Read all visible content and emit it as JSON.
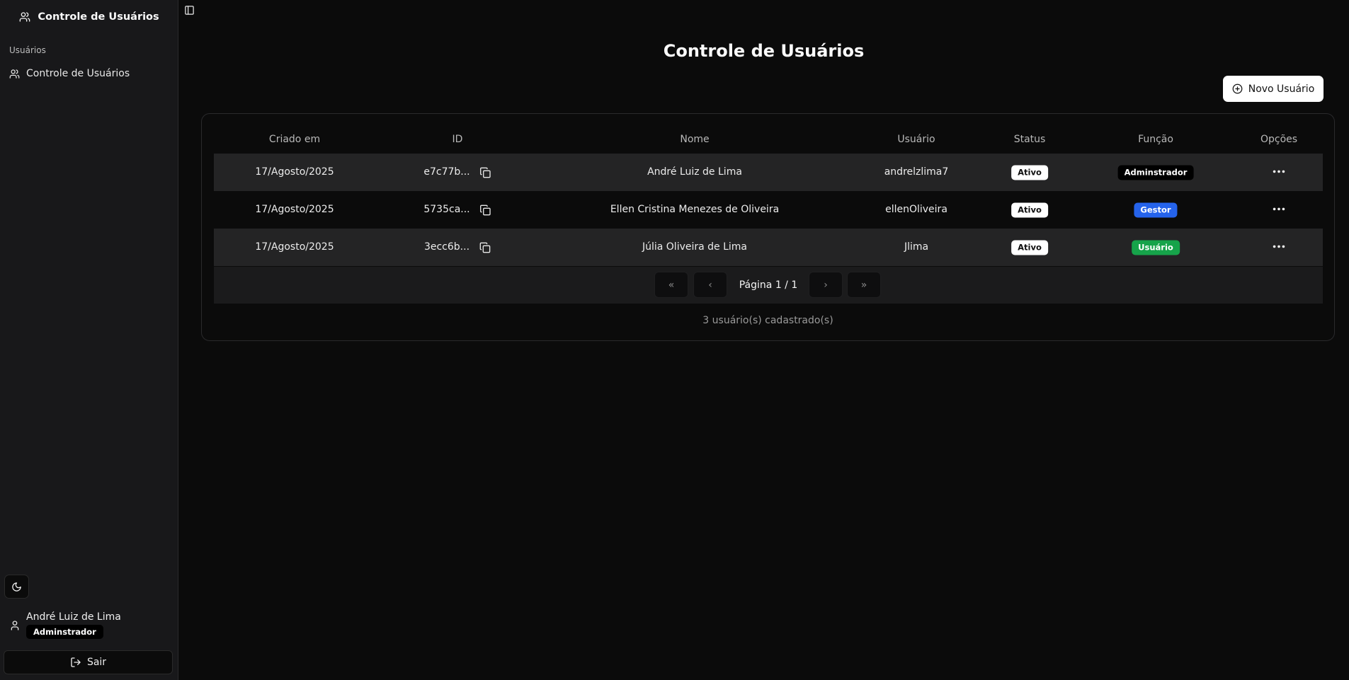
{
  "sidebar": {
    "app_title": "Controle de Usuários",
    "group_label": "Usuários",
    "items": [
      {
        "label": "Controle de Usuários",
        "icon": "users-icon"
      }
    ],
    "user": {
      "name": "André Luiz de Lima",
      "role": "Adminstrador"
    },
    "logout_label": "Sair"
  },
  "main": {
    "title": "Controle de Usuários",
    "new_user_label": "Novo Usuário",
    "table": {
      "columns": [
        "Criado em",
        "ID",
        "Nome",
        "Usuário",
        "Status",
        "Função",
        "Opções"
      ],
      "rows": [
        {
          "created": "17/Agosto/2025",
          "id": "e7c77b...",
          "name": "André Luiz de Lima",
          "username": "andrelzlima7",
          "status": "Ativo",
          "role": "Adminstrador",
          "role_color": "#000000"
        },
        {
          "created": "17/Agosto/2025",
          "id": "5735ca...",
          "name": "Ellen Cristina Menezes de Oliveira",
          "username": "ellenOliveira",
          "status": "Ativo",
          "role": "Gestor",
          "role_color": "#2563eb"
        },
        {
          "created": "17/Agosto/2025",
          "id": "3ecc6b...",
          "name": "Júlia Oliveira de Lima",
          "username": "Jlima",
          "status": "Ativo",
          "role": "Usuário",
          "role_color": "#16a34a"
        }
      ]
    },
    "pagination": {
      "label": "Página 1 / 1",
      "first": "«",
      "prev": "‹",
      "next": "›",
      "last": "»"
    },
    "footer_count": "3 usuário(s) cadastrado(s)"
  },
  "colors": {
    "background": "#0b0b0b",
    "sidebar": "#18181a",
    "row_alt": "#242425",
    "badge_admin": "#000000",
    "badge_gestor": "#2563eb",
    "badge_usuario": "#16a34a"
  }
}
